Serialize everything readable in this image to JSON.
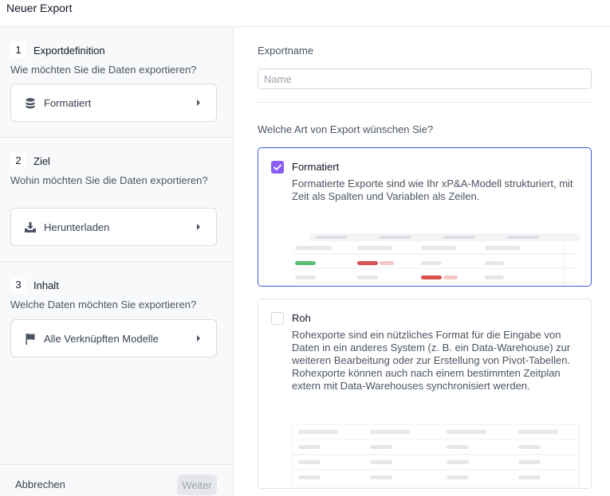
{
  "header": {
    "title": "Neuer Export"
  },
  "steps": [
    {
      "number": "1",
      "title": "Exportdefinition",
      "question": "Wie möchten Sie die Daten exportieren?",
      "value": "Formatiert",
      "icon": "database-icon"
    },
    {
      "number": "2",
      "title": "Ziel",
      "question": "Wohin möchten Sie die Daten exportieren?",
      "value": "Herunterladen",
      "icon": "download-tray-icon"
    },
    {
      "number": "3",
      "title": "Inhalt",
      "question": "Welche Daten möchten Sie exportieren?",
      "value": "Alle Verknüpften Modelle",
      "icon": "flag-icon"
    }
  ],
  "footer": {
    "cancel_label": "Abbrechen",
    "next_label": "Weiter"
  },
  "main": {
    "name_label": "Exportname",
    "name_placeholder": "Name",
    "name_value": "",
    "question": "Welche Art von Export wünschen Sie?",
    "options": [
      {
        "title": "Formatiert",
        "description": "Formatierte Exporte sind wie Ihr xP&A-Modell strukturiert, mit Zeit als Spalten und Variablen als Zeilen.",
        "checked": true
      },
      {
        "title": "Roh",
        "description": "Rohexporte sind ein nützliches Format für die Eingabe von Daten in ein anderes System (z. B. ein Data-Warehouse) zur weiteren Bearbeitung oder zur Erstellung von Pivot-Tabellen. Rohexporte können auch nach einem bestimmten Zeitplan extern mit Data-Warehouses synchronisiert werden.",
        "checked": false
      }
    ]
  },
  "colors": {
    "accent": "#8b5cf6",
    "selected_border": "#3b5bdb",
    "positive": "#5cbf73",
    "negative": "#d9534f",
    "negative_light": "#f5c6c6"
  }
}
